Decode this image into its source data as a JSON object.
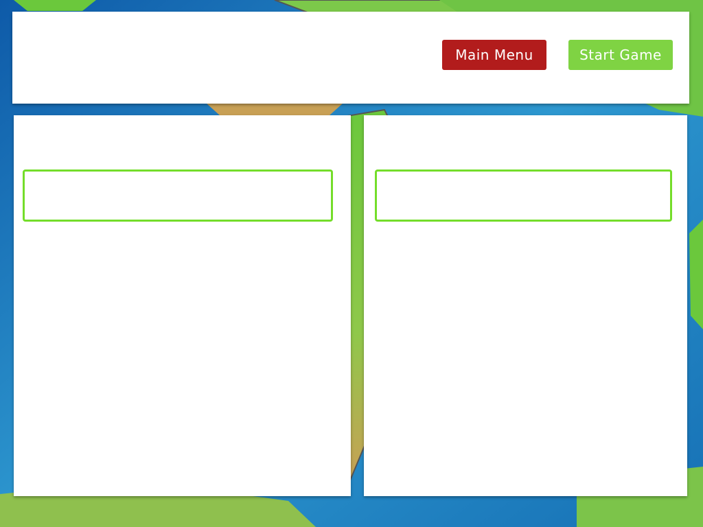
{
  "header": {
    "main_menu_label": "Main Menu",
    "start_game_label": "Start Game"
  },
  "colors": {
    "main_menu_bg": "#b21c1c",
    "start_game_bg": "#7fd343",
    "slot_border": "#74dd2a",
    "panel_bg": "#ffffff"
  }
}
